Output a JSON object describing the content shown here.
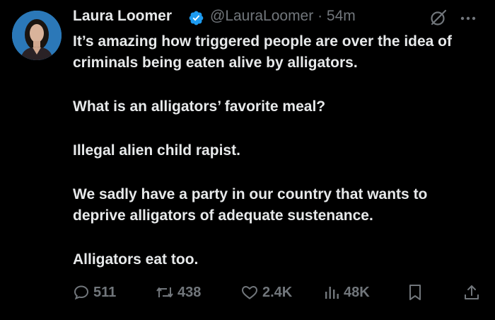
{
  "author": {
    "display_name": "Laura Loomer",
    "handle": "@LauraLoomer",
    "separator": "·",
    "time_ago": "54m",
    "verified": true,
    "verified_color": "#1d9bf0"
  },
  "tweet": {
    "paragraphs": [
      "It’s amazing how triggered people are over the idea of criminals being eaten alive by alligators.",
      "What is an alligators’ favorite meal?",
      "Illegal alien child rapist.",
      "We sadly have a party in our country that wants to deprive alligators of adequate sustenance.",
      "Alligators eat too."
    ]
  },
  "actions": {
    "replies": "511",
    "reposts": "438",
    "likes": "2.4K",
    "views": "48K"
  },
  "icons": {
    "grok": "grok-icon",
    "more": "more-icon",
    "reply": "reply-icon",
    "repost": "repost-icon",
    "like": "heart-icon",
    "views": "views-icon",
    "bookmark": "bookmark-icon",
    "share": "share-icon"
  },
  "colors": {
    "background": "#000000",
    "text": "#e7e9ea",
    "muted": "#71767b",
    "accent": "#1d9bf0"
  }
}
